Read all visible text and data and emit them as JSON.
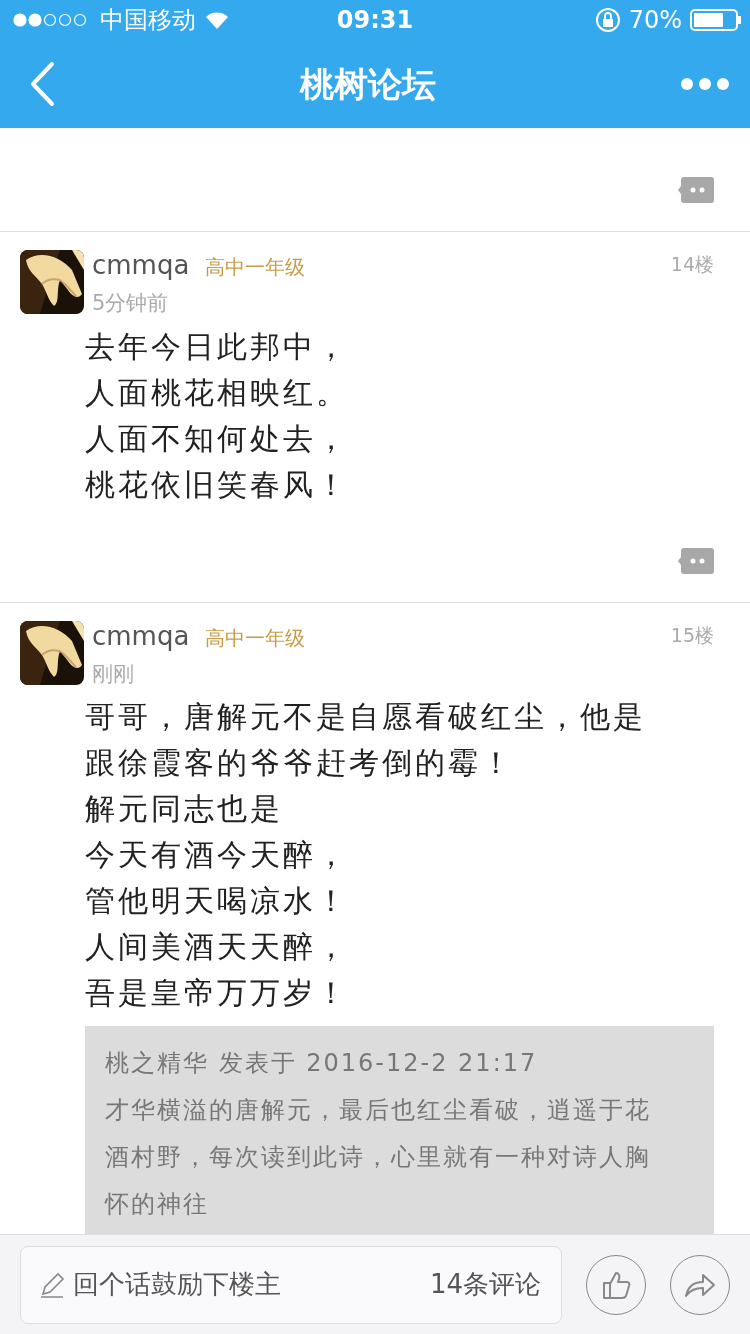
{
  "status_bar": {
    "carrier": "中国移动",
    "time": "09:31",
    "battery": "70%"
  },
  "nav": {
    "title": "桃树论坛"
  },
  "posts": [
    {
      "user": "cmmqa",
      "rank": "高中一年级",
      "time": "5分钟前",
      "floor": "14楼",
      "lines": [
        "去年今日此邦中，",
        "人面桃花相映红。",
        "人面不知何处去，",
        "桃花依旧笑春风！"
      ]
    },
    {
      "user": "cmmqa",
      "rank": "高中一年级",
      "time": "刚刚",
      "floor": "15楼",
      "lines": [
        "哥哥，唐解元不是自愿看破红尘，他是",
        "跟徐霞客的爷爷赶考倒的霉！",
        "解元同志也是",
        "今天有酒今天醉，",
        "管他明天喝凉水！",
        "人间美酒天天醉，",
        "吾是皇帝万万岁！"
      ],
      "quote": {
        "header": "桃之精华 发表于 2016-12-2 21:17",
        "lines": [
          "才华横溢的唐解元，最后也红尘看破，逍遥于花",
          "酒村野，每次读到此诗，心里就有一种对诗人胸",
          "怀的神往"
        ]
      }
    }
  ],
  "composer": {
    "placeholder": "回个话鼓励下楼主",
    "count": "14条评论"
  }
}
